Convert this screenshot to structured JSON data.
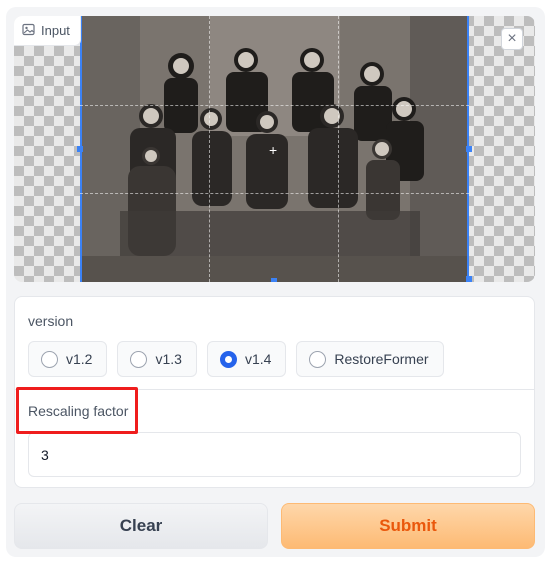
{
  "image_input": {
    "label": "Input",
    "close_symbol": "×",
    "crosshair": "+",
    "photo_description": "old black-and-white family portrait"
  },
  "version": {
    "label": "version",
    "options": [
      {
        "label": "v1.2",
        "checked": false
      },
      {
        "label": "v1.3",
        "checked": false
      },
      {
        "label": "v1.4",
        "checked": true
      },
      {
        "label": "RestoreFormer",
        "checked": false
      }
    ]
  },
  "rescale": {
    "label": "Rescaling factor",
    "value": "3"
  },
  "buttons": {
    "clear": "Clear",
    "submit": "Submit"
  },
  "colors": {
    "accent_blue": "#2563eb",
    "submit_orange": "#ea580c",
    "highlight_red": "#ef1d1d"
  }
}
